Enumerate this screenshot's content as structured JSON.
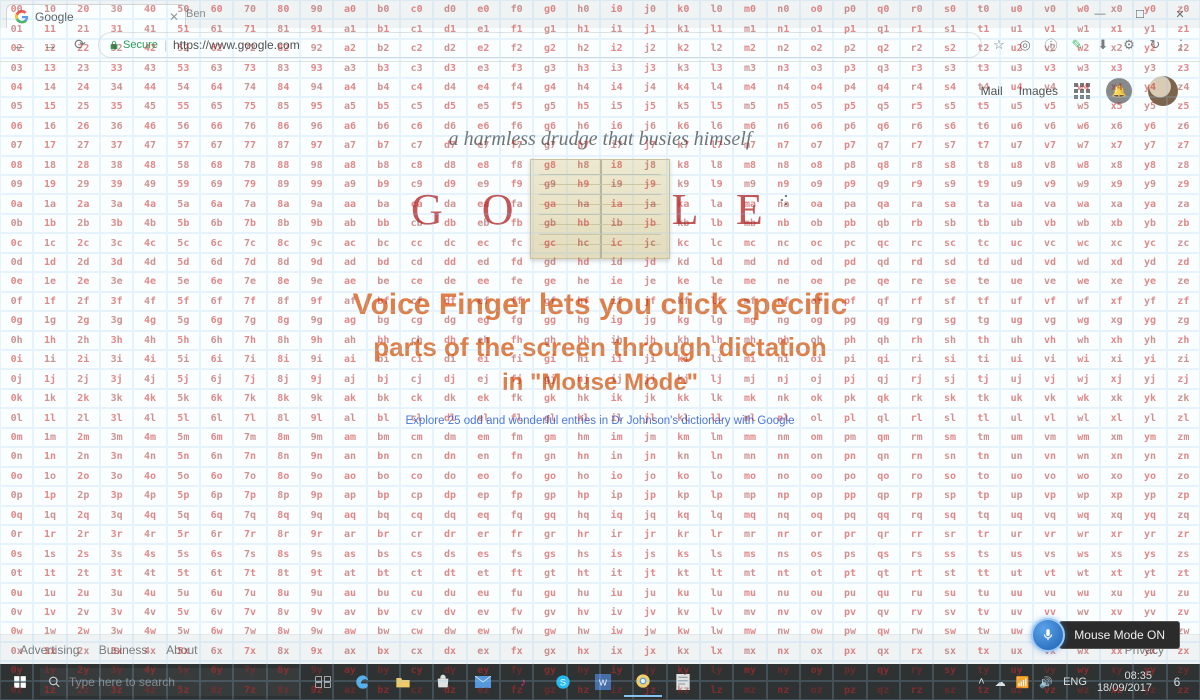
{
  "browser": {
    "tab_title": "Google",
    "user_badge": "Ben",
    "win": {
      "min": "—",
      "max": "☐",
      "close": "✕"
    },
    "back": "←",
    "fwd": "→",
    "reload": "⟳",
    "secure_label": "Secure",
    "url": "https://www.google.com",
    "ext_icons": [
      "☆",
      "⊕",
      "①",
      "ⓔ",
      "ⓝ",
      "⚙",
      "⋮"
    ]
  },
  "google": {
    "top_links": {
      "mail": "Mail",
      "images": "Images"
    },
    "drudge": "a harmless drudge that busies himself",
    "logo_left": "G O",
    "logo_right": "L E",
    "headline_l1": "Voice Finger lets you click specific",
    "headline_l2": "parts of the screen through dictation",
    "headline_l3": "in \"Mouse Mode\"",
    "explore": "Explore 25 odd and wonderful entries in Dr Johnson's dictionary with Google",
    "footer": {
      "adv": "Advertising",
      "biz": "Business",
      "about": "About",
      "priv": "Privacy"
    }
  },
  "voicefinger": {
    "status": "Mouse Mode ON",
    "grid": {
      "cols_first": [
        "0",
        "1",
        "2",
        "3",
        "4",
        "5",
        "6",
        "7",
        "8",
        "9",
        "a",
        "b",
        "c",
        "d",
        "e",
        "f",
        "g",
        "h",
        "i",
        "j",
        "k",
        "l",
        "m",
        "n",
        "o",
        "p",
        "q",
        "r",
        "s",
        "t",
        "u",
        "v",
        "w",
        "x",
        "y",
        "z"
      ],
      "rows_second": [
        "0",
        "1",
        "2",
        "3",
        "4",
        "5",
        "6",
        "7",
        "8",
        "9",
        "a",
        "b",
        "c",
        "d",
        "e",
        "f",
        "g",
        "h",
        "i",
        "j",
        "k",
        "l",
        "m",
        "n",
        "o",
        "p",
        "q",
        "r",
        "s",
        "t",
        "u",
        "v",
        "w",
        "x",
        "y",
        "z"
      ]
    }
  },
  "taskbar": {
    "search_placeholder": "Type here to search",
    "lang": "ENG",
    "time": "08:35",
    "date": "18/09/2017",
    "notif_count": "6"
  }
}
